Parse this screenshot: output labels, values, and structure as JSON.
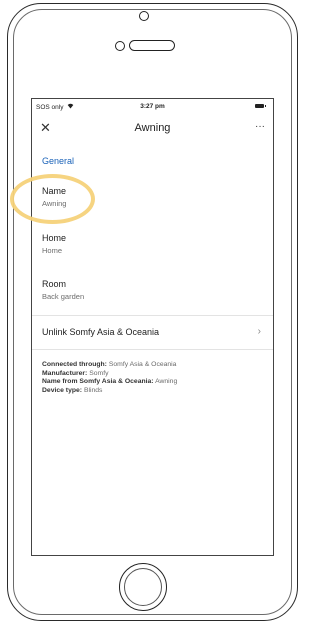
{
  "status_bar": {
    "carrier": "SOS only",
    "wifi_icon": "wifi-icon",
    "time": "3:27 pm",
    "battery_icon": "battery-icon"
  },
  "app_bar": {
    "close_glyph": "✕",
    "title": "Awning",
    "more_glyph": "···"
  },
  "section": {
    "title": "General"
  },
  "fields": [
    {
      "label": "Name",
      "value": "Awning"
    },
    {
      "label": "Home",
      "value": "Home"
    },
    {
      "label": "Room",
      "value": "Back garden"
    }
  ],
  "unlink": {
    "label": "Unlink Somfy Asia & Oceania",
    "chevron": "›"
  },
  "info": {
    "connected_label": "Connected through:",
    "connected_value": "Somfy Asia & Oceania",
    "manufacturer_label": "Manufacturer:",
    "manufacturer_value": "Somfy",
    "name_from_label": "Name from Somfy Asia & Oceania:",
    "name_from_value": "Awning",
    "device_type_label": "Device type:",
    "device_type_value": "Blinds"
  },
  "colors": {
    "accent": "#1a62b8",
    "highlight": "#f5d27a",
    "text": "#222222",
    "secondary": "#6d6d6d"
  }
}
